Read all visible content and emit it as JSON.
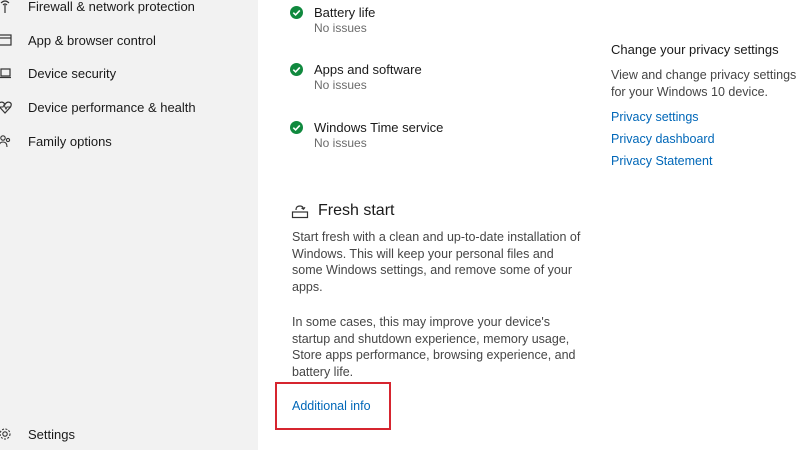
{
  "sidebar": {
    "items": [
      {
        "label": "Firewall & network protection",
        "icon": "wifi-antenna-icon"
      },
      {
        "label": "App & browser control",
        "icon": "app-window-icon"
      },
      {
        "label": "Device security",
        "icon": "laptop-icon"
      },
      {
        "label": "Device performance & health",
        "icon": "heart-pulse-icon"
      },
      {
        "label": "Family options",
        "icon": "family-icon"
      }
    ],
    "settings_label": "Settings"
  },
  "main": {
    "checks": [
      {
        "title": "Battery life",
        "status": "No issues"
      },
      {
        "title": "Apps and software",
        "status": "No issues"
      },
      {
        "title": "Windows Time service",
        "status": "No issues"
      }
    ],
    "fresh_start": {
      "title": "Fresh start",
      "paragraph1": "Start fresh with a clean and up-to-date installation of Windows. This will keep your personal files and some Windows settings, and remove some of your apps.",
      "paragraph2": "In some cases, this may improve your device's startup and shutdown experience, memory usage, Store apps performance, browsing experience, and battery life.",
      "link": "Additional info"
    }
  },
  "privacy": {
    "title": "Change your privacy settings",
    "description": "View and change privacy settings for your Windows 10 device.",
    "links": [
      "Privacy settings",
      "Privacy dashboard",
      "Privacy Statement"
    ]
  },
  "colors": {
    "accent_link": "#0067b8",
    "status_ok": "#10893e",
    "highlight_box": "#d6252f",
    "sidebar_bg": "#f2f2f2"
  }
}
